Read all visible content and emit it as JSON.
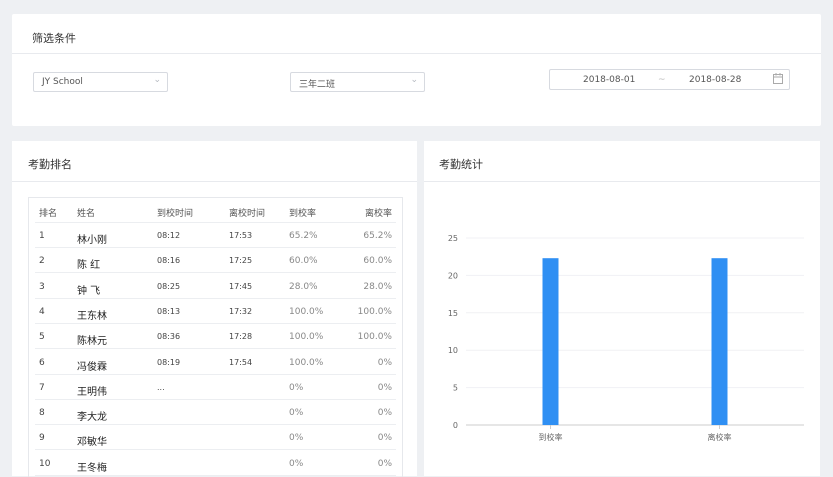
{
  "filter": {
    "title": "筛选条件",
    "school": "JY School",
    "class": "三年二班",
    "date_start": "2018-08-01",
    "date_sep": "~",
    "date_end": "2018-08-28"
  },
  "ranking": {
    "title": "考勤排名",
    "headers": {
      "rank": "排名",
      "name": "姓名",
      "arrive": "到校时间",
      "leave": "离校时间",
      "arrive_rate": "到校率",
      "leave_rate": "离校率"
    },
    "rows": [
      {
        "rank": "1",
        "name": "林小刚",
        "arrive": "08:12",
        "leave": "17:53",
        "arrive_rate": "65.2%",
        "leave_rate": "65.2%"
      },
      {
        "rank": "2",
        "name": "陈  红",
        "arrive": "08:16",
        "leave": "17:25",
        "arrive_rate": "60.0%",
        "leave_rate": "60.0%"
      },
      {
        "rank": "3",
        "name": "钟  飞",
        "arrive": "08:25",
        "leave": "17:45",
        "arrive_rate": "28.0%",
        "leave_rate": "28.0%"
      },
      {
        "rank": "4",
        "name": "王东林",
        "arrive": "08:13",
        "leave": "17:32",
        "arrive_rate": "100.0%",
        "leave_rate": "100.0%"
      },
      {
        "rank": "5",
        "name": "陈林元",
        "arrive": "08:36",
        "leave": "17:28",
        "arrive_rate": "100.0%",
        "leave_rate": "100.0%"
      },
      {
        "rank": "6",
        "name": "冯俊霖",
        "arrive": "08:19",
        "leave": "17:54",
        "arrive_rate": "100.0%",
        "leave_rate": "0%"
      },
      {
        "rank": "7",
        "name": "王明伟",
        "arrive": "...",
        "leave": "",
        "arrive_rate": "0%",
        "leave_rate": "0%"
      },
      {
        "rank": "8",
        "name": "李大龙",
        "arrive": "",
        "leave": "",
        "arrive_rate": "0%",
        "leave_rate": "0%"
      },
      {
        "rank": "9",
        "name": "邓敏华",
        "arrive": "",
        "leave": "",
        "arrive_rate": "0%",
        "leave_rate": "0%"
      },
      {
        "rank": "10",
        "name": "王冬梅",
        "arrive": "",
        "leave": "",
        "arrive_rate": "0%",
        "leave_rate": "0%"
      }
    ]
  },
  "stats": {
    "title": "考勤统计"
  },
  "chart_data": {
    "type": "bar",
    "categories": [
      "到校率",
      "离校率"
    ],
    "values": [
      22.3,
      22.3
    ],
    "ylim": [
      0,
      25
    ],
    "yticks": [
      0,
      5,
      10,
      15,
      20,
      25
    ],
    "grid": true,
    "bar_color": "#2f8ff3"
  }
}
